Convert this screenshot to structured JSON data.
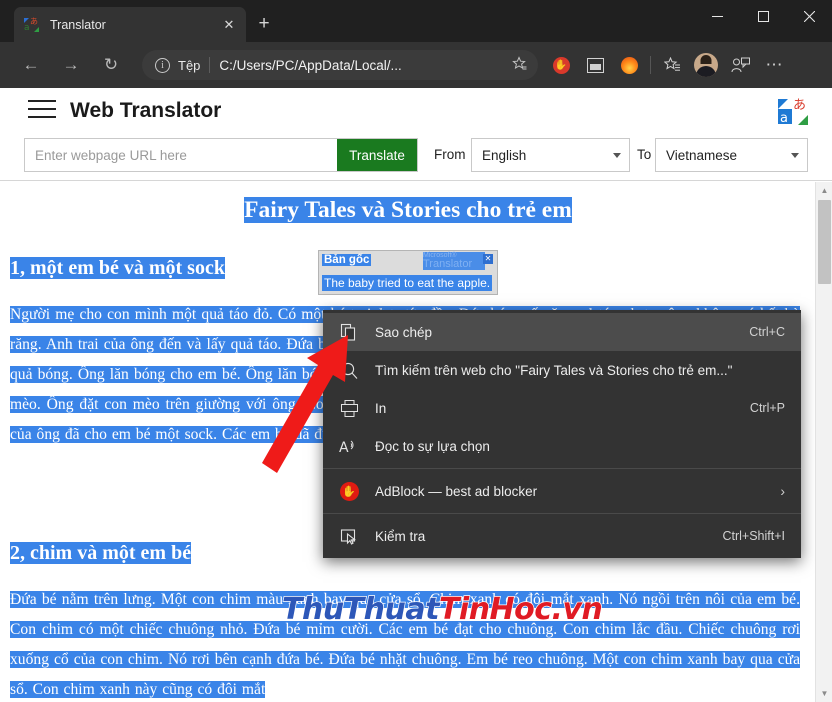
{
  "browser": {
    "tab": {
      "title": "Translator",
      "favicon_icon": "translator-favicon",
      "close_icon": "close-icon"
    },
    "new_tab_label": "+",
    "window_controls": {
      "minimize": "—",
      "maximize": "☐",
      "close": "✕"
    },
    "nav": {
      "back_icon": "←",
      "forward_icon": "→",
      "reload_icon": "↻"
    },
    "omnibox": {
      "info_icon": "i",
      "scheme_label": "Tệp",
      "url": "C:/Users/PC/AppData/Local/...",
      "favorite_icon": "☆"
    },
    "toolbar": {
      "adblock_glyph": "✋",
      "split_screen_glyph": "▣",
      "fire_glyph": "",
      "collections_glyph": "☆",
      "profile_glyph": "",
      "share_glyph": "↱",
      "more_glyph": "⋯"
    }
  },
  "app": {
    "menu_icon": "hamburger-icon",
    "title": "Web Translator",
    "logo_icon": "microsoft-translator-logo",
    "url_input": {
      "value": "",
      "placeholder": "Enter webpage URL here"
    },
    "translate_button": "Translate",
    "from_label": "From",
    "from_value": "English",
    "to_label": "To",
    "to_value": "Vietnamese"
  },
  "article": {
    "title": "Fairy Tales và Stories cho trẻ em",
    "heading1": "1, một em bé và một sock",
    "paragraph1": "Người mẹ cho con mình một quả táo đỏ. Có một bé trai ở trước đầy. Đứa bé muốn ăn quả táo nhưng ông không có bất kỳ răng. Anh trai của ông đến và lấy quả táo. Đứa bé bắt đầu khóc. Ông đã cho em bé một quả bóng màu xanh. Đứa bé thích quả bóng. Ông lăn bóng cho em bé. Ông lăn bóng trên sàn nhà. nâu và trắng con mèo đang ngủ trên ghế. Đứa bé thấy con mèo. Ông đặt con mèo trên giường với ông. Con mèo đã chạy đi. Đứa bé đuổi theo con mèo. Đứa bé lại khóc. Anh trai của ông đã cho em bé một sock. Các em bé đã được hạnh phúc.",
    "heading2": "2, chim và một em bé",
    "paragraph2": "Đứa bé nằm trên lưng. Một con chim màu xanh bay qua cửa sổ. Chim xanh có đôi mắt xanh. Nó ngồi trên nôi của em bé. Con chim có một chiếc chuông nhỏ. Đứa bé mỉm cười. Các em bé đạt cho chuông. Con chim lắc đầu. Chiếc chuông rơi xuống cổ của con chim. Nó rơi bên cạnh đứa bé. Đứa bé nhặt chuông. Em bé reo chuông. Một con chim xanh bay qua cửa sổ. Con chim xanh này cũng có đôi mắt"
  },
  "translator_tooltip": {
    "original_label": "Bản gốc",
    "brand_line1": "Microsoft®",
    "brand_line2": "Translator",
    "close_label": "✕",
    "translated_text": "The baby tried to eat the apple."
  },
  "context_menu": {
    "items": [
      {
        "icon": "copy-icon",
        "label": "Sao chép",
        "accel": "Ctrl+C",
        "hover": true,
        "separator_after": false,
        "chevron": false
      },
      {
        "icon": "search-icon",
        "label": "Tìm kiếm trên web cho \"Fairy Tales và Stories cho trẻ em...\"",
        "accel": "",
        "hover": false,
        "separator_after": false,
        "chevron": false
      },
      {
        "icon": "print-icon",
        "label": "In",
        "accel": "Ctrl+P",
        "hover": false,
        "separator_after": false,
        "chevron": false
      },
      {
        "icon": "read-aloud-icon",
        "label": "Đọc to sự lựa chọn",
        "accel": "",
        "hover": false,
        "separator_after": true,
        "chevron": false
      },
      {
        "icon": "adblock-icon",
        "label": "AdBlock — best ad blocker",
        "accel": "",
        "hover": false,
        "separator_after": true,
        "chevron": true
      },
      {
        "icon": "inspect-icon",
        "label": "Kiểm tra",
        "accel": "Ctrl+Shift+I",
        "hover": false,
        "separator_after": false,
        "chevron": false
      }
    ]
  },
  "watermark": {
    "part1": "ThuThuat",
    "part2": "TinHoc.vn"
  },
  "colors": {
    "selection_blue": "#3a84e8",
    "translate_green": "#1a7a1f",
    "menu_bg": "#333333",
    "menu_hover": "#4c4c4c",
    "adblock_red": "#e01b12",
    "arrow_red": "#ef1b19",
    "chrome_bg": "#333333",
    "titlebar_bg": "#202020"
  }
}
